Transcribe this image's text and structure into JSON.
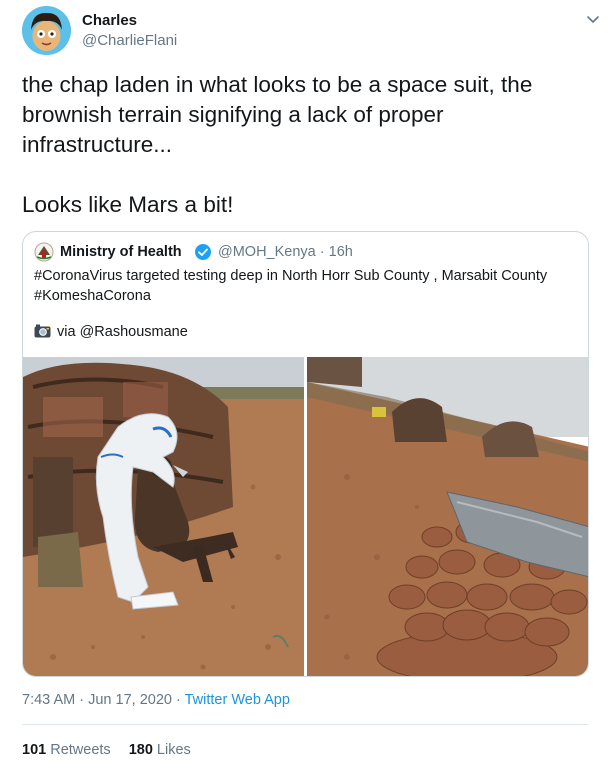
{
  "author": {
    "name": "Charles",
    "handle": "@CharlieFlani"
  },
  "tweet": {
    "text": "the chap laden in what looks to be a space suit, the brownish terrain signifying a lack of proper infrastructure...\n\nLooks like Mars a bit!"
  },
  "quoted": {
    "name": "Ministry of Health",
    "handle": "@MOH_Kenya",
    "separator": "·",
    "age": "16h",
    "text": "#CoronaVirus targeted testing deep in North Horr Sub County , Marsabit County\n#KomeshaCorona",
    "via": "via @Rashousmane",
    "icons": [
      "ministry-logo-icon",
      "verified-badge-icon",
      "camera-icon"
    ]
  },
  "meta": {
    "time": "7:43 AM",
    "sep1": "·",
    "date": "Jun 17, 2020",
    "sep2": "·",
    "app": "Twitter Web App"
  },
  "stats": {
    "retweets_count": "101",
    "retweets_label": "Retweets",
    "likes_count": "180",
    "likes_label": "Likes"
  },
  "colors": {
    "link": "#1b95e0",
    "secondary_text": "#657786",
    "border": "#ccd6dd",
    "verified": "#1da1f2"
  }
}
